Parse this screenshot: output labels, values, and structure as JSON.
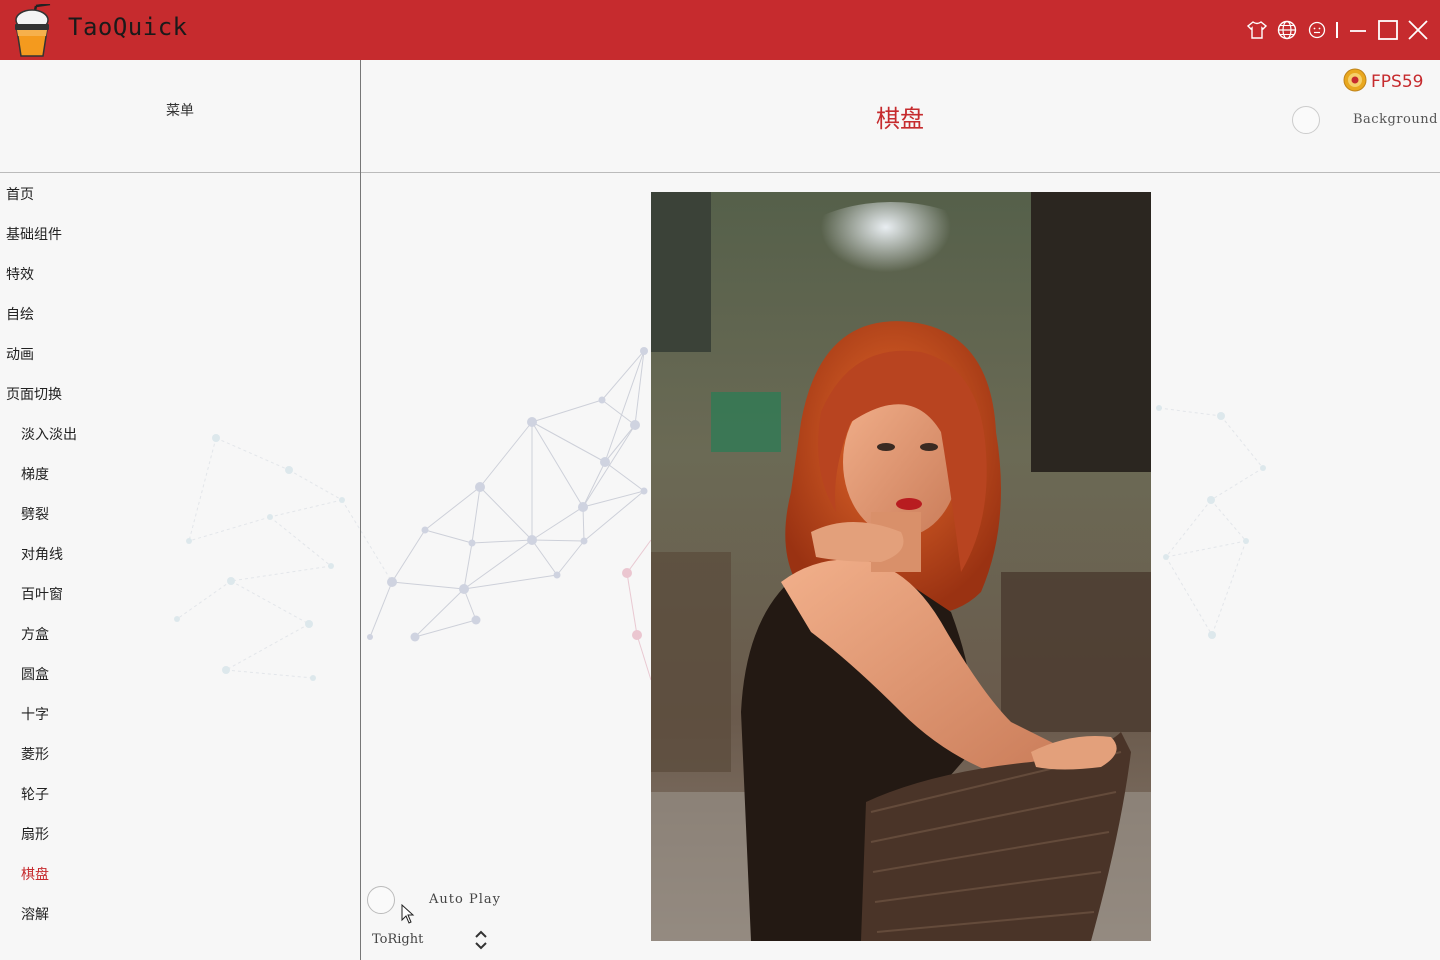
{
  "app": {
    "title": "TaoQuick"
  },
  "titlebar": {
    "icons": [
      "skin-icon",
      "language-icon",
      "about-icon",
      "minimize-icon",
      "maximize-icon",
      "close-icon"
    ]
  },
  "fps": {
    "label": "FPS59"
  },
  "sidebar": {
    "header": "菜单",
    "items": [
      {
        "label": "首页",
        "level": 0
      },
      {
        "label": "基础组件",
        "level": 0
      },
      {
        "label": "特效",
        "level": 0
      },
      {
        "label": "自绘",
        "level": 0
      },
      {
        "label": "动画",
        "level": 0
      },
      {
        "label": "页面切换",
        "level": 0
      },
      {
        "label": "淡入淡出",
        "level": 1
      },
      {
        "label": "梯度",
        "level": 1
      },
      {
        "label": "劈裂",
        "level": 1
      },
      {
        "label": "对角线",
        "level": 1
      },
      {
        "label": "百叶窗",
        "level": 1
      },
      {
        "label": "方盒",
        "level": 1
      },
      {
        "label": "圆盒",
        "level": 1
      },
      {
        "label": "十字",
        "level": 1
      },
      {
        "label": "菱形",
        "level": 1
      },
      {
        "label": "轮子",
        "level": 1
      },
      {
        "label": "扇形",
        "level": 1
      },
      {
        "label": "棋盘",
        "level": 1,
        "selected": true
      },
      {
        "label": "溶解",
        "level": 1
      }
    ]
  },
  "main": {
    "title": "棋盘",
    "background_label": "Background",
    "autoplay_label": "Auto Play",
    "direction_value": "ToRight"
  },
  "colors": {
    "accent": "#c62b2e",
    "titlebar": "#c62b2e",
    "background": "#f7f7f7"
  }
}
